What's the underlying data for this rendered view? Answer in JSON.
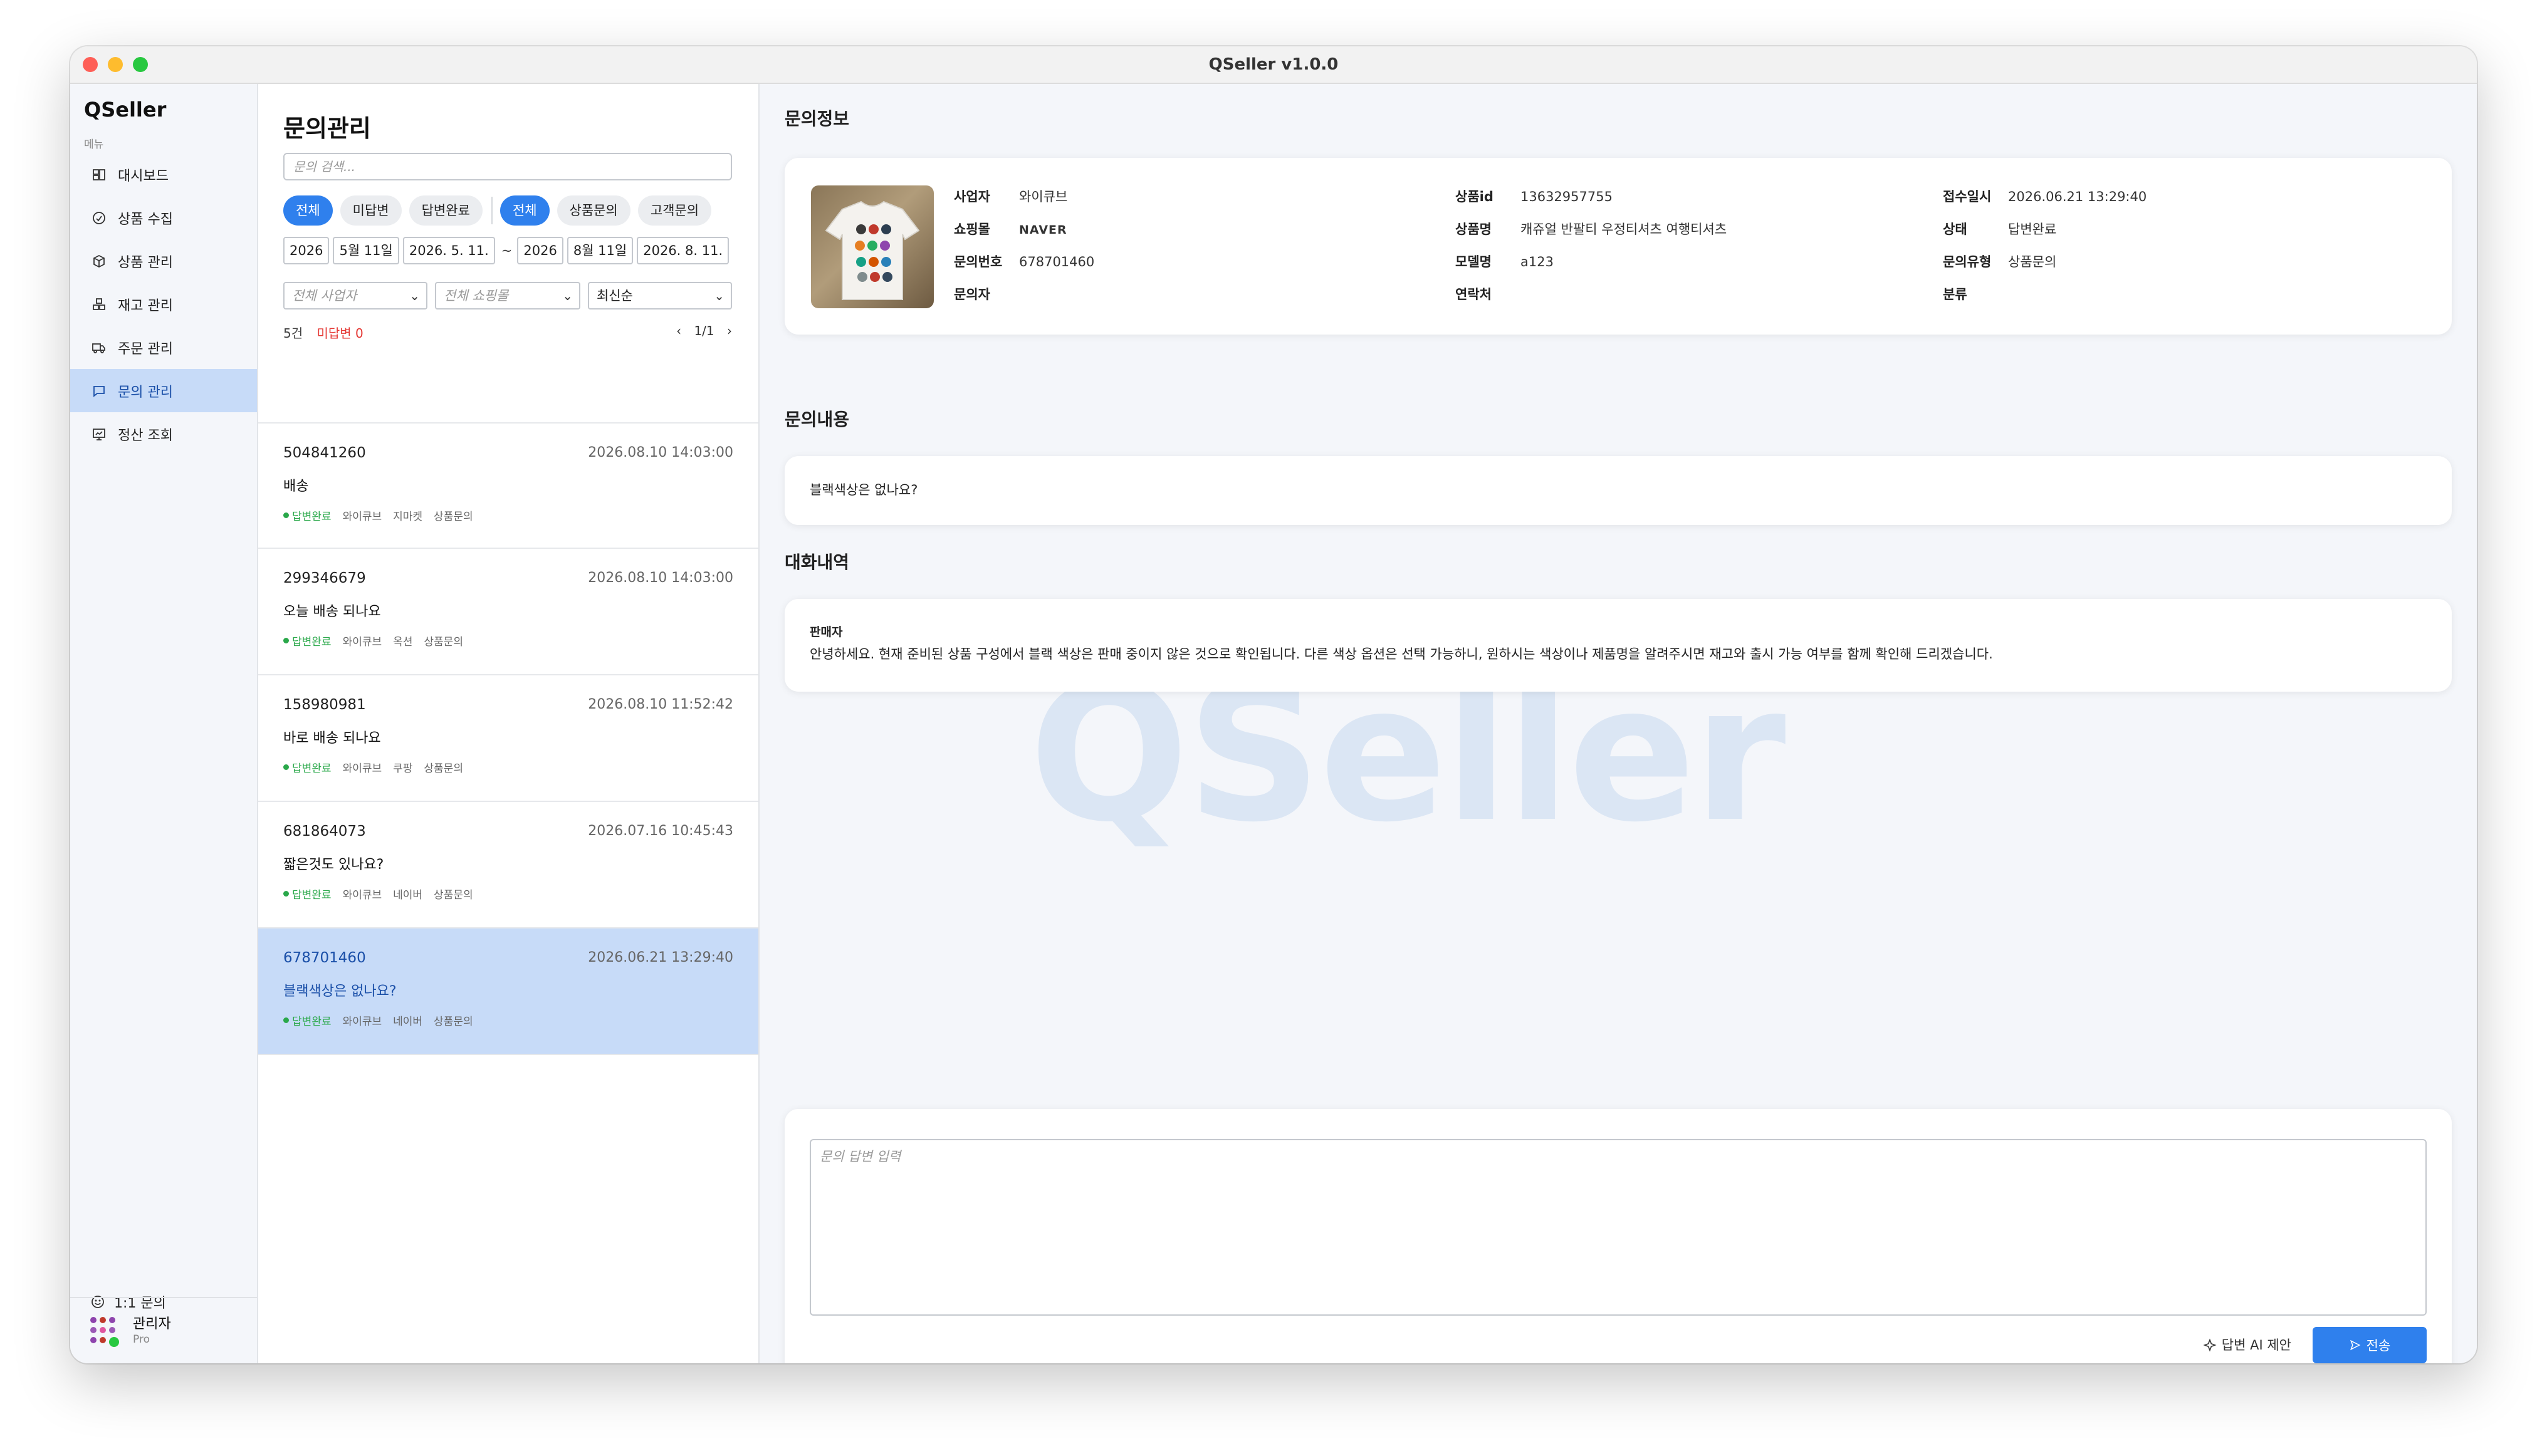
{
  "window": {
    "title": "QSeller v1.0.0"
  },
  "sidebar": {
    "brand": "QSeller",
    "menu_label": "메뉴",
    "items": [
      {
        "label": "대시보드",
        "icon": "dashboard-icon"
      },
      {
        "label": "상품 수집",
        "icon": "collect-icon"
      },
      {
        "label": "상품 관리",
        "icon": "box-icon"
      },
      {
        "label": "재고 관리",
        "icon": "stock-icon"
      },
      {
        "label": "주문 관리",
        "icon": "truck-icon"
      },
      {
        "label": "문의 관리",
        "icon": "chat-icon",
        "active": true
      },
      {
        "label": "정산 조회",
        "icon": "settlement-icon"
      }
    ],
    "one_inquiry": "1:1 문의",
    "user": {
      "name": "관리자",
      "plan": "Pro"
    }
  },
  "list": {
    "title": "문의관리",
    "search_placeholder": "문의 검색...",
    "status_chips": [
      "전체",
      "미답변",
      "답변완료"
    ],
    "type_chips": [
      "전체",
      "상품문의",
      "고객문의"
    ],
    "date_from": {
      "year": "2026",
      "month_day": "5월 11일",
      "full": "2026. 5. 11."
    },
    "date_sep": "~",
    "date_to": {
      "year": "2026",
      "month_day": "8월 11일",
      "full": "2026. 8. 11."
    },
    "filters": {
      "business": "전체 사업자",
      "mall": "전체 쇼핑몰",
      "sort": "최신순"
    },
    "count": "5건",
    "unanswered": "미답변 0",
    "page": "1/1",
    "prev": "‹",
    "next": "›",
    "items": [
      {
        "id": "504841260",
        "time": "2026.08.10 14:03:00",
        "text": "배송",
        "status": "답변완료",
        "business": "와이큐브",
        "mall": "지마켓",
        "type": "상품문의"
      },
      {
        "id": "299346679",
        "time": "2026.08.10 14:03:00",
        "text": "오늘 배송 되나요",
        "status": "답변완료",
        "business": "와이큐브",
        "mall": "옥션",
        "type": "상품문의"
      },
      {
        "id": "158980981",
        "time": "2026.08.10 11:52:42",
        "text": "바로 배송 되나요",
        "status": "답변완료",
        "business": "와이큐브",
        "mall": "쿠팡",
        "type": "상품문의"
      },
      {
        "id": "681864073",
        "time": "2026.07.16 10:45:43",
        "text": "짧은것도  있나요?",
        "status": "답변완료",
        "business": "와이큐브",
        "mall": "네이버",
        "type": "상품문의"
      },
      {
        "id": "678701460",
        "time": "2026.06.21 13:29:40",
        "text": "블랙색상은 없나요?",
        "status": "답변완료",
        "business": "와이큐브",
        "mall": "네이버",
        "type": "상품문의",
        "selected": true
      }
    ]
  },
  "detail": {
    "watermark": "QSeller",
    "info_title": "문의정보",
    "info": {
      "business_k": "사업자",
      "business_v": "와이큐브",
      "mall_k": "쇼핑몰",
      "mall_v": "NAVER",
      "inquiry_no_k": "문의번호",
      "inquiry_no_v": "678701460",
      "inquirer_k": "문의자",
      "inquirer_v": "",
      "product_id_k": "상품id",
      "product_id_v": "13632957755",
      "product_name_k": "상품명",
      "product_name_v": "캐쥬얼 반팔티 우정티셔츠 여행티셔츠",
      "model_k": "모델명",
      "model_v": "a123",
      "contact_k": "연락처",
      "contact_v": "",
      "received_k": "접수일시",
      "received_v": "2026.06.21 13:29:40",
      "status_k": "상태",
      "status_v": "답변완료",
      "type_k": "문의유형",
      "type_v": "상품문의",
      "category_k": "분류",
      "category_v": ""
    },
    "content_title": "문의내용",
    "content": "블랙색상은 없나요?",
    "history_title": "대화내역",
    "history": {
      "who": "판매자",
      "message": "안녕하세요. 현재 준비된 상품 구성에서 블랙 색상은 판매 중이지 않은 것으로 확인됩니다. 다른 색상 옵션은 선택 가능하니, 원하시는 색상이나 제품명을 알려주시면 재고와 출시 가능 여부를 함께 확인해 드리겠습니다."
    },
    "reply_placeholder": "문의 답변 입력",
    "ai_button": "답변 AI 제안",
    "send_button": "전송"
  },
  "colors": {
    "accent": "#2f80ed",
    "selected_row": "#c7dbf8",
    "answered": "#2aa84a",
    "unanswered": "#e53935",
    "naver": "#03c75a"
  }
}
